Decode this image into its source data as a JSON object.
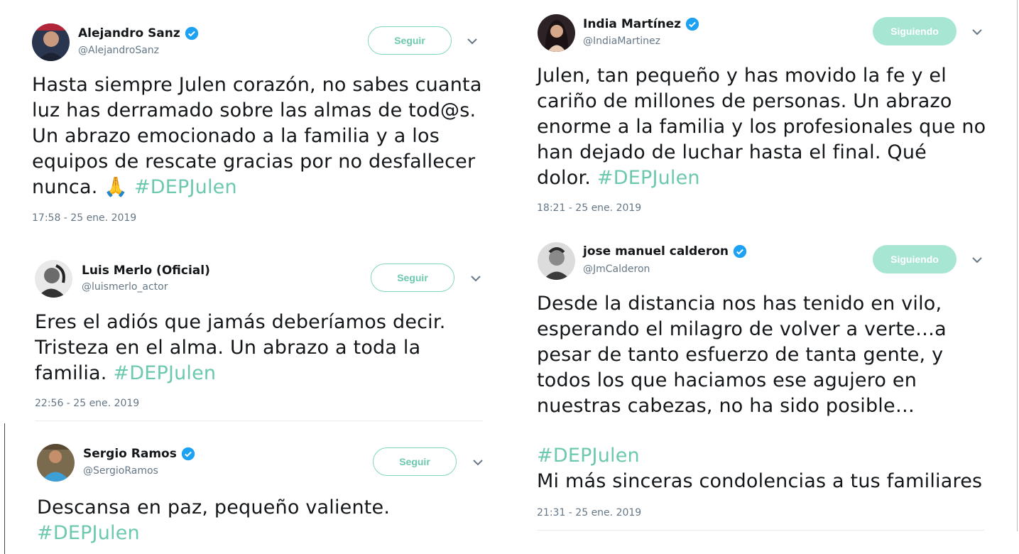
{
  "colors": {
    "accent": "#6cc8ae",
    "follow_border": "#7fd6bf",
    "following_bg": "#a7e6d3",
    "verified": "#1da1f2"
  },
  "tweets": [
    {
      "name": "Alejandro Sanz",
      "handle": "@AlejandroSanz",
      "verified": true,
      "button": "Seguir",
      "lines": [
        "Hasta siempre Julen corazón, no sabes cuanta",
        "luz has derramado sobre las almas de tod@s.",
        "Un abrazo  emocionado a la familia y a los",
        "equipos de rescate gracias por no desfallecer",
        "nunca."
      ],
      "emoji": "🙏",
      "hashtag": "#DEPJulen",
      "time": "17:58 - 25 ene. 2019"
    },
    {
      "name": "Luis Merlo (Oficial)",
      "handle": "@luismerlo_actor",
      "verified": false,
      "button": "Seguir",
      "lines": [
        "Eres el adiós que jamás deberíamos decir.",
        "Tristeza en el alma. Un abrazo a toda la",
        "familia."
      ],
      "hashtag": "#DEPJulen",
      "time": "22:56 - 25 ene. 2019"
    },
    {
      "name": "Sergio Ramos",
      "handle": "@SergioRamos",
      "verified": true,
      "button": "Seguir",
      "lines": [
        "Descansa en paz, pequeño valiente."
      ],
      "hashtag": "#DEPJulen"
    },
    {
      "name": "India Martínez",
      "handle": "@IndiaMartinez",
      "verified": true,
      "button": "Siguiendo",
      "lines": [
        "Julen, tan pequeño y has movido la fe y el",
        "cariño de millones de personas. Un abrazo",
        "enorme a la familia y los profesionales que no",
        "han dejado de luchar hasta el final. Qué",
        "dolor."
      ],
      "hashtag": "#DEPJulen",
      "time": "18:21 - 25 ene. 2019"
    },
    {
      "name": "jose manuel calderon",
      "handle": "@JmCalderon",
      "verified": true,
      "button": "Siguiendo",
      "lines": [
        "Desde la distancia nos has tenido en vilo,",
        "esperando el milagro de volver a verte…a",
        "pesar de tanto esfuerzo de tanta gente, y",
        "todos los que haciamos ese agujero en",
        "nuestras cabezas, no ha sido posible…"
      ],
      "hashtag": "#DEPJulen",
      "line_after": "Mi más sinceras condolencias a tus familiares",
      "time": "21:31 - 25 ene. 2019"
    }
  ]
}
